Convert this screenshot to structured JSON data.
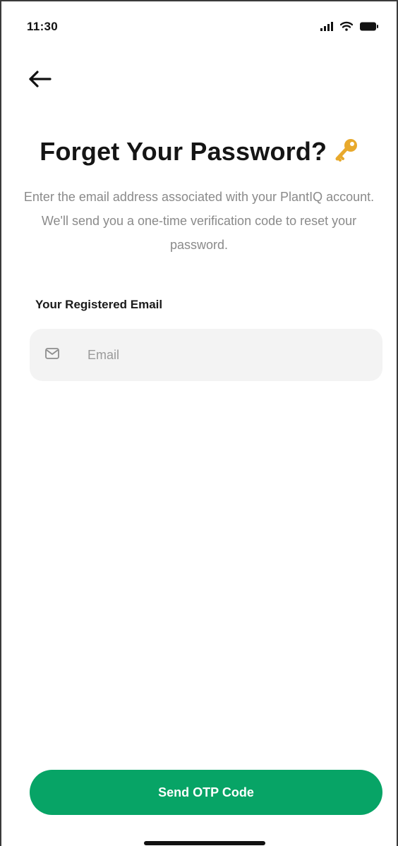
{
  "status_bar": {
    "time": "11:30",
    "icons": [
      "signal-icon",
      "wifi-icon",
      "battery-icon"
    ]
  },
  "header": {
    "back_icon": "arrow-left-icon"
  },
  "title": {
    "text": "Forget Your Password?",
    "emoji_icon": "key-icon"
  },
  "subtitle": "Enter the email address associated with your PlantIQ account. We'll send you a one-time verification code to reset your password.",
  "form": {
    "email_label": "Your Registered Email",
    "email_placeholder": "Email",
    "email_value": "",
    "email_icon": "mail-icon"
  },
  "actions": {
    "send_label": "Send OTP Code"
  },
  "colors": {
    "primary": "#07a466",
    "input_bg": "#f3f3f3",
    "muted_text": "#8a8a8a",
    "title_text": "#151515"
  }
}
